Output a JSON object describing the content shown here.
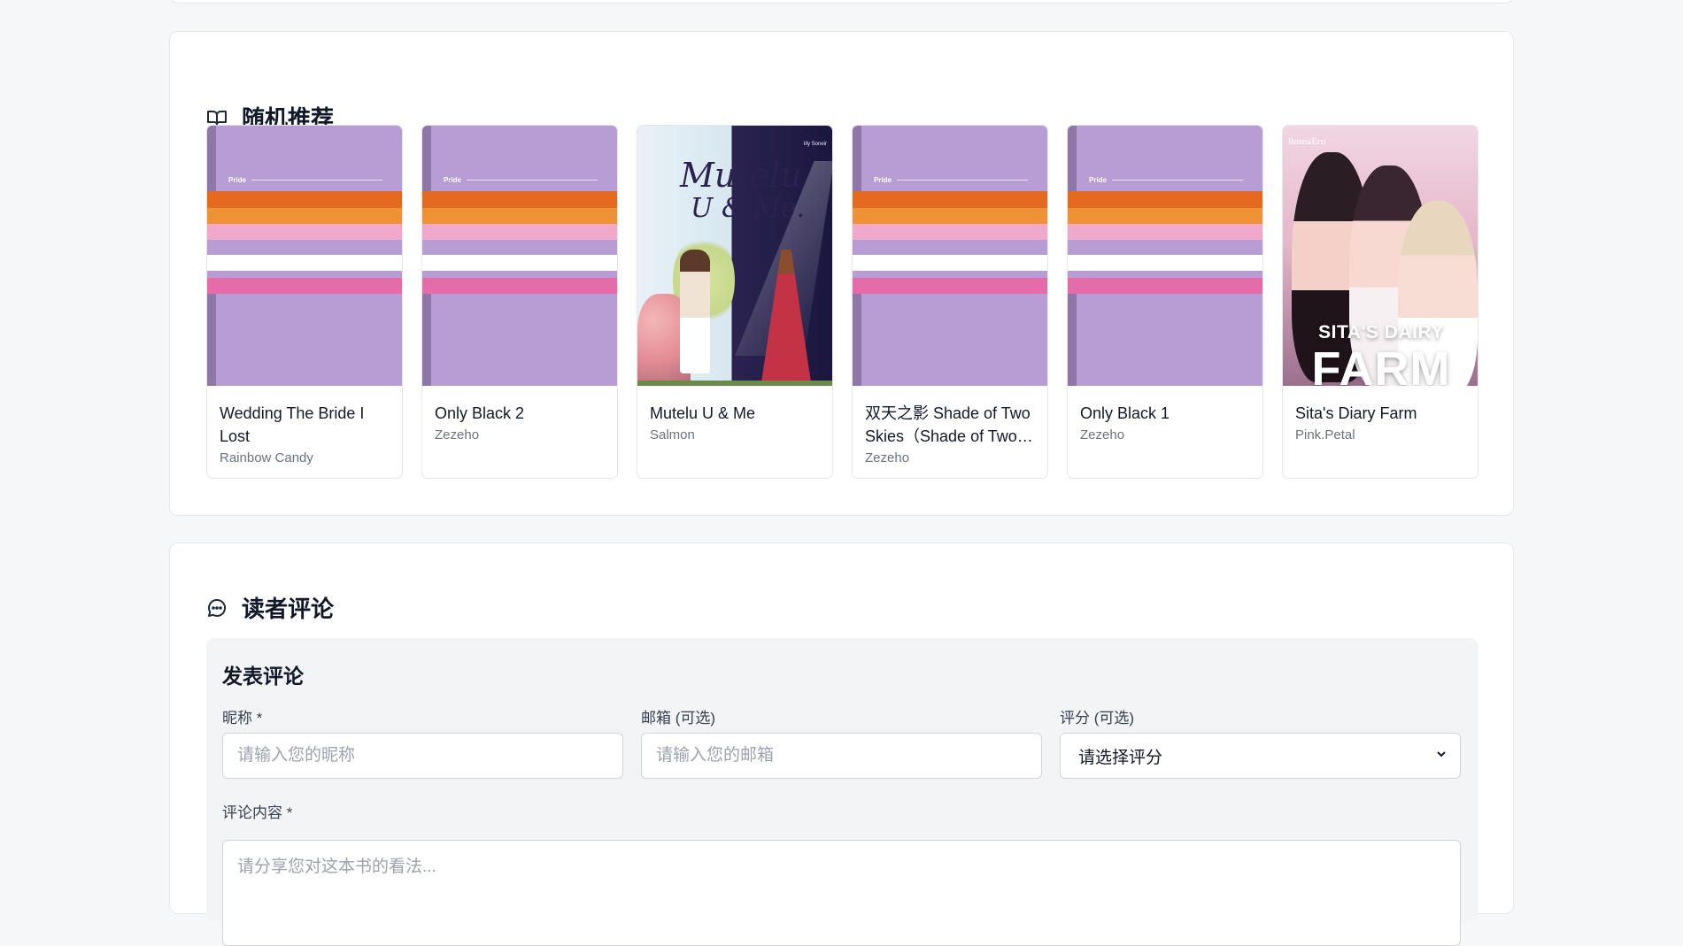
{
  "recommend": {
    "title": "随机推荐",
    "icon": "book-open-icon",
    "books": [
      {
        "title": "Wedding The Bride I Lost",
        "author": "Rainbow Candy",
        "cover": "pride",
        "cover_brand": "Pride"
      },
      {
        "title": "Only Black 2",
        "author": "Zezeho",
        "cover": "pride",
        "cover_brand": "Pride"
      },
      {
        "title": "Mutelu U & Me",
        "author": "Salmon",
        "cover": "mutelu",
        "cover_text": "Mutelu",
        "cover_text2": "U & Me.",
        "cover_credit": "lily Soneir"
      },
      {
        "title": "双天之影 Shade of Two Skies（Shade of Two Skies）",
        "author": "Zezeho",
        "cover": "pride",
        "cover_brand": "Pride"
      },
      {
        "title": "Only Black 1",
        "author": "Zezeho",
        "cover": "pride",
        "cover_brand": "Pride"
      },
      {
        "title": "Sita's Diary Farm",
        "author": "Pink.Petal",
        "cover": "sita",
        "cover_studio": "RomaEro",
        "cover_line1": "SITA'S DAIRY",
        "cover_line2": "FARM"
      }
    ]
  },
  "comments": {
    "title": "读者评论",
    "icon": "chat-bubble-icon",
    "form_title": "发表评论",
    "nickname_label": "昵称 *",
    "nickname_placeholder": "请输入您的昵称",
    "email_label": "邮箱 (可选)",
    "email_placeholder": "请输入您的邮箱",
    "rating_label": "评分 (可选)",
    "rating_selected": "请选择评分",
    "content_label": "评论内容 *",
    "content_placeholder": "请分享您对这本书的看法..."
  },
  "colors": {
    "accent_pride_purple": "#b89cd4",
    "card_border": "#e5e7eb",
    "page_bg": "#f6f7f9"
  }
}
